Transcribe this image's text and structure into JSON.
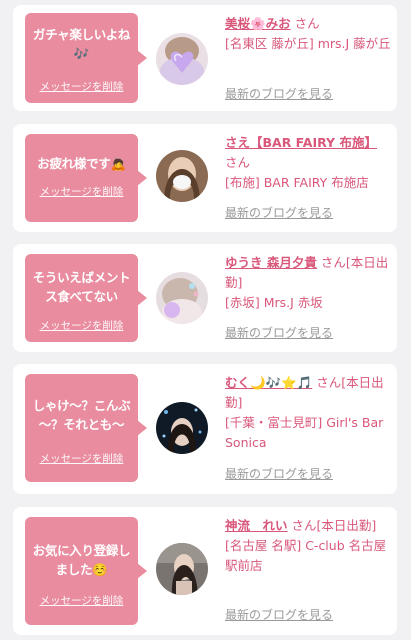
{
  "colors": {
    "accent": "#e98c9f",
    "name_pink": "#d9577a",
    "muted": "#9a9a9a",
    "background": "#f1f1f3"
  },
  "delete_label": "メッセージを削除",
  "blog_label": "最新のブログを見る",
  "cards": [
    {
      "message": "ガチャ楽しいよね🎶",
      "name": "美桜🌸みお",
      "san": "さん",
      "shop": "[名東区 藤が丘] mrs.J 藤が丘"
    },
    {
      "message": "お疲れ様です🙇",
      "name": "さえ【BAR FAIRY 布施】",
      "san": "さん",
      "shop": "[布施] BAR FAIRY 布施店"
    },
    {
      "message": "そういえばメントス食べてない",
      "name": "ゆうき 森月夕貴",
      "san": "さん[本日出勤]",
      "shop": "[赤坂] Mrs.J 赤坂"
    },
    {
      "message": "しゃけ～？こんぶ～？それとも～",
      "name": "むく🌙🎶⭐🎵",
      "san": "さん[本日出勤]",
      "shop": "[千葉・富士見町] Girl's Bar Sonica"
    },
    {
      "message": "お気に入り登録しました☺️",
      "name": "神流　れい",
      "san": "さん[本日出勤]",
      "shop": "[名古屋 名駅] C-club 名古屋駅前店"
    }
  ]
}
